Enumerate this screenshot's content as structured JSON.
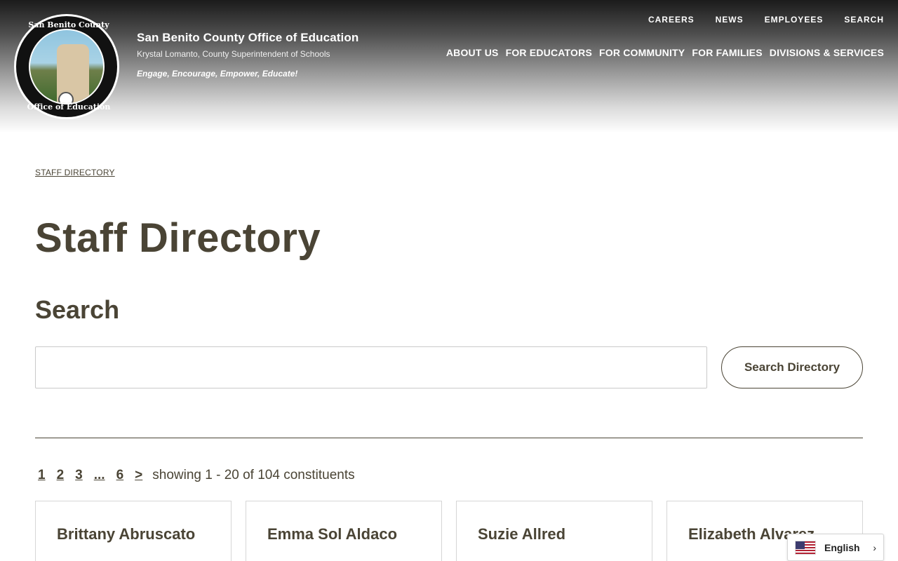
{
  "header": {
    "seal_text_top": "San Benito County",
    "seal_text_bottom": "Office of Education",
    "org_name": "San Benito County Office of Education",
    "org_sub": "Krystal Lomanto, County Superintendent of Schools",
    "org_tagline": "Engage, Encourage, Empower, Educate!",
    "utility_nav": [
      "CAREERS",
      "NEWS",
      "EMPLOYEES",
      "SEARCH"
    ],
    "main_nav": [
      "ABOUT US",
      "FOR EDUCATORS",
      "FOR COMMUNITY",
      "FOR FAMILIES",
      "DIVISIONS & SERVICES"
    ]
  },
  "breadcrumb": "STAFF DIRECTORY",
  "page_title": "Staff Directory",
  "search": {
    "heading": "Search",
    "input_value": "",
    "button_label": "Search Directory"
  },
  "pager": {
    "pages": [
      "1",
      "2",
      "3",
      "...",
      "6",
      ">"
    ],
    "showing": "showing 1 - 20 of 104 constituents"
  },
  "cards": [
    {
      "name": "Brittany Abruscato"
    },
    {
      "name": "Emma Sol Aldaco"
    },
    {
      "name": "Suzie Allred"
    },
    {
      "name": "Elizabeth Alvarez"
    }
  ],
  "language": {
    "label": "English",
    "flag_icon": "us-flag-icon",
    "chevron_icon": "chevron-right-icon"
  }
}
